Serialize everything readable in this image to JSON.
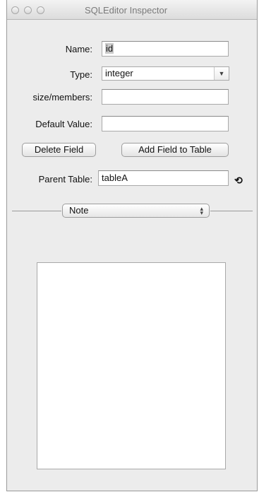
{
  "window": {
    "title": "SQLEditor Inspector"
  },
  "form": {
    "name_label": "Name:",
    "name_value": "id",
    "type_label": "Type:",
    "type_value": "integer",
    "size_label": "size/members:",
    "size_value": "",
    "default_label": "Default Value:",
    "default_value": ""
  },
  "buttons": {
    "delete_field": "Delete Field",
    "add_field": "Add Field to Table"
  },
  "parent": {
    "label": "Parent Table:",
    "value": "tableA"
  },
  "section": {
    "popup_value": "Note"
  },
  "note": {
    "text": ""
  },
  "icons": {
    "window_close": "circle",
    "window_minimize": "circle",
    "window_zoom": "circle",
    "type_dropdown": "triangle-down",
    "parent_navigate": "loop-arrow",
    "section_popup": "up-down-arrows"
  }
}
